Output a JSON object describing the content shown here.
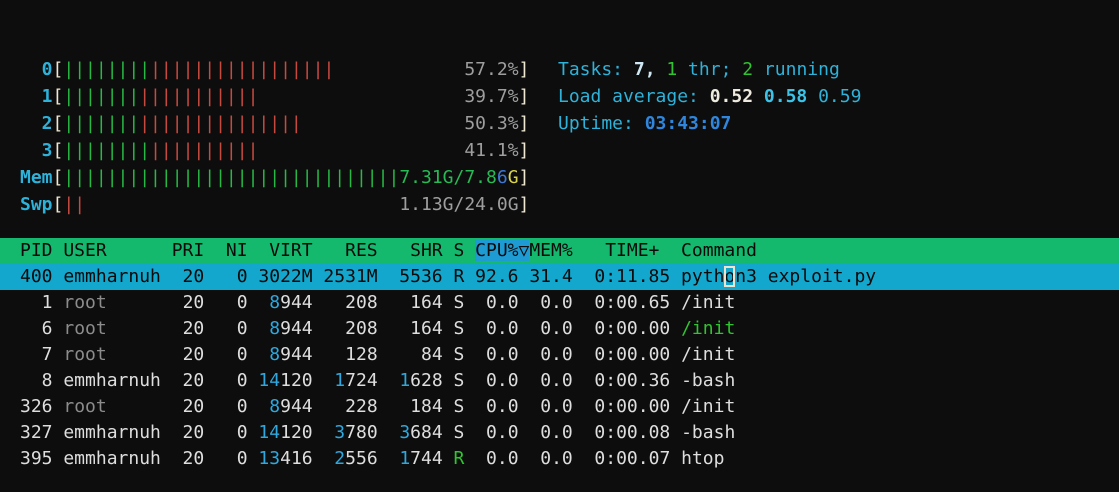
{
  "app_title": "htop",
  "colors": {
    "background": "#0d0d0d",
    "label_cyan": "#2eb2d9",
    "bracket_cream": "#efe8d2",
    "meter_green": "#27b845",
    "meter_red": "#c64a40",
    "value_gray": "#9e9e9e",
    "text_white": "#dedede",
    "dim_gray": "#8c8c8c",
    "digit_cyan": "#2ea8de",
    "green": "#31c431",
    "header_bg_green": "#14b96d",
    "sort_column_bg_blue": "#1e9bd3",
    "selected_row_bg_cyan": "#14a7cd",
    "mem_blue": "#3d78d4",
    "mem_yellow": "#d9d54d",
    "bold_blue": "#2f86dc"
  },
  "meters": {
    "bar_area_chars": 42,
    "bar_glyph": "|",
    "cpus": [
      {
        "label": "0",
        "green_bars": 8,
        "red_bars": 17,
        "value": "57.2%"
      },
      {
        "label": "1",
        "green_bars": 7,
        "red_bars": 11,
        "value": "39.7%"
      },
      {
        "label": "2",
        "green_bars": 7,
        "red_bars": 15,
        "value": "50.3%"
      },
      {
        "label": "3",
        "green_bars": 8,
        "red_bars": 10,
        "value": "41.1%"
      }
    ],
    "mem": {
      "label": "Mem",
      "green_bars": 31,
      "value_segments": [
        [
          "7.31G/7.8",
          "memGreen"
        ],
        [
          "6",
          "memBlue"
        ],
        [
          "G",
          "memYellow"
        ]
      ]
    },
    "swp": {
      "label": "Swp",
      "red_bars": 2,
      "value": "1.13G/24.0G"
    }
  },
  "summary": {
    "tasks_segments": [
      [
        "Tasks: ",
        "cyan"
      ],
      [
        "7, ",
        "bpale"
      ],
      [
        "1",
        "g"
      ],
      [
        " thr; ",
        "cyan"
      ],
      [
        "2",
        "g"
      ],
      [
        " running",
        "cyan"
      ]
    ],
    "load_segments": [
      [
        "Load average: ",
        "cyan"
      ],
      [
        "0.52 ",
        "bwhite"
      ],
      [
        "0.58 ",
        "bcyan"
      ],
      [
        "0.59",
        "cyan"
      ]
    ],
    "uptime_segments": [
      [
        "Uptime: ",
        "cyan"
      ],
      [
        "03:43:07",
        "bblue"
      ]
    ]
  },
  "table": {
    "sort_column": "CPU%",
    "sort_indicator": "▽",
    "header_segments": [
      [
        "PID USER      PRI  NI  VIRT   RES   SHR S ",
        "hdr"
      ],
      [
        "CPU%▽",
        "sort"
      ],
      [
        "MEM%   TIME+  Command",
        "hdr"
      ]
    ],
    "rows": [
      {
        "pid": "400",
        "selected": true,
        "segments": [
          [
            "400 emmharnuh  20   0 3022M 2531M  5536 R 92.6 31.4  0:11.85 pyth",
            "sel"
          ],
          [
            "o",
            "cur"
          ],
          [
            "n3 exploit.py",
            "sel"
          ]
        ]
      },
      {
        "pid": "1",
        "selected": false,
        "segments": [
          [
            "  1 ",
            "w"
          ],
          [
            "root",
            "dim"
          ],
          [
            "       20   0  ",
            "w"
          ],
          [
            "8",
            "num"
          ],
          [
            "944   208   164 S  0.0  0.0  0:00.65 /init",
            "w"
          ]
        ]
      },
      {
        "pid": "6",
        "selected": false,
        "segments": [
          [
            "  6 ",
            "w"
          ],
          [
            "root",
            "dim"
          ],
          [
            "       20   0  ",
            "w"
          ],
          [
            "8",
            "num"
          ],
          [
            "944   208   164 S  0.0  0.0  0:00.00 ",
            "w"
          ],
          [
            "/init",
            "g"
          ]
        ]
      },
      {
        "pid": "7",
        "selected": false,
        "segments": [
          [
            "  7 ",
            "w"
          ],
          [
            "root",
            "dim"
          ],
          [
            "       20   0  ",
            "w"
          ],
          [
            "8",
            "num"
          ],
          [
            "944   128    84 S  0.0  0.0  0:00.00 /init",
            "w"
          ]
        ]
      },
      {
        "pid": "8",
        "selected": false,
        "segments": [
          [
            "  8 emmharnuh  20   0 ",
            "w"
          ],
          [
            "14",
            "num"
          ],
          [
            "120  ",
            "w"
          ],
          [
            "1",
            "num"
          ],
          [
            "724  ",
            "w"
          ],
          [
            "1",
            "num"
          ],
          [
            "628 S  0.0  0.0  0:00.36 -bash",
            "w"
          ]
        ]
      },
      {
        "pid": "326",
        "selected": false,
        "segments": [
          [
            "326 ",
            "w"
          ],
          [
            "root",
            "dim"
          ],
          [
            "       20   0  ",
            "w"
          ],
          [
            "8",
            "num"
          ],
          [
            "944   228   184 S  0.0  0.0  0:00.00 /init",
            "w"
          ]
        ]
      },
      {
        "pid": "327",
        "selected": false,
        "segments": [
          [
            "327 emmharnuh  20   0 ",
            "w"
          ],
          [
            "14",
            "num"
          ],
          [
            "120  ",
            "w"
          ],
          [
            "3",
            "num"
          ],
          [
            "780  ",
            "w"
          ],
          [
            "3",
            "num"
          ],
          [
            "684 S  0.0  0.0  0:00.08 -bash",
            "w"
          ]
        ]
      },
      {
        "pid": "395",
        "selected": false,
        "segments": [
          [
            "395 emmharnuh  20   0 ",
            "w"
          ],
          [
            "13",
            "num"
          ],
          [
            "416  ",
            "w"
          ],
          [
            "2",
            "num"
          ],
          [
            "556  ",
            "w"
          ],
          [
            "1",
            "num"
          ],
          [
            "744 ",
            "w"
          ],
          [
            "R",
            "g"
          ],
          [
            "  0.0  0.0  0:00.07 htop",
            "w"
          ]
        ]
      }
    ]
  }
}
